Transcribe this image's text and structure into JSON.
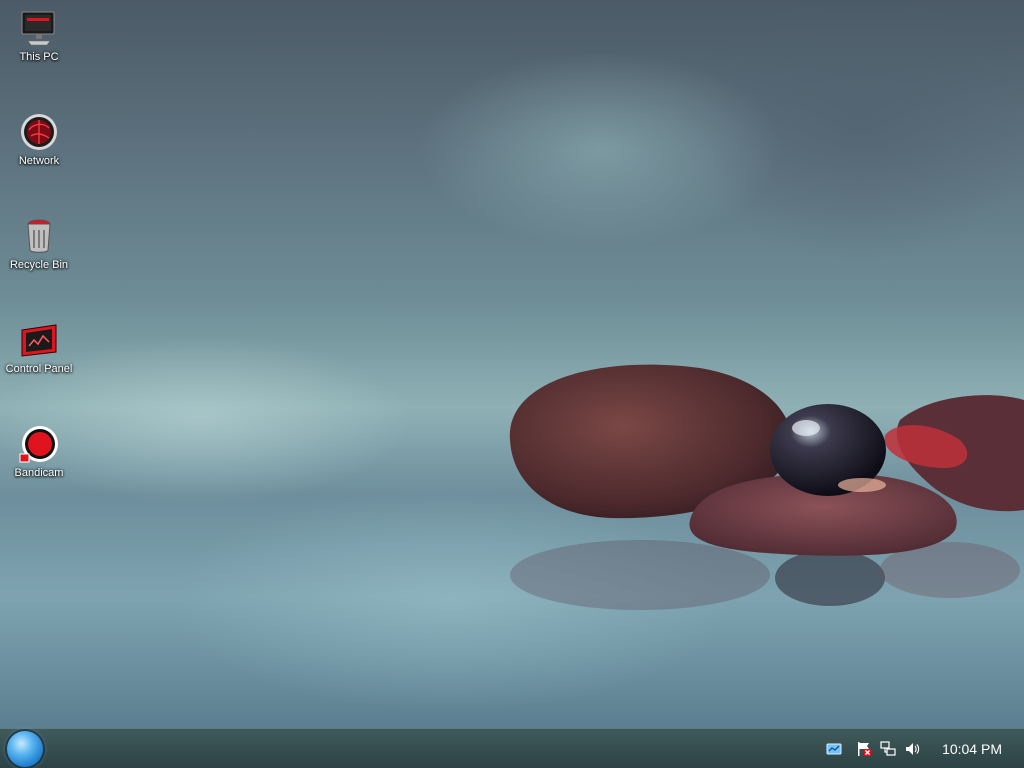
{
  "desktop": {
    "icons": [
      {
        "label": "This PC",
        "icon": "computer-icon"
      },
      {
        "label": "Network",
        "icon": "network-icon"
      },
      {
        "label": "Recycle Bin",
        "icon": "recycle-bin-icon"
      },
      {
        "label": "Control Panel",
        "icon": "control-panel-icon"
      },
      {
        "label": "Bandicam",
        "icon": "bandicam-icon"
      }
    ]
  },
  "taskbar": {
    "start_icon": "start-orb-icon",
    "tray_icons": [
      "action-center-icon",
      "flag-icon",
      "network-icon",
      "volume-icon"
    ],
    "clock": "10:04 PM"
  },
  "colors": {
    "taskbar": "#34494b",
    "accent_red": "#e0141e",
    "start_orb": "#2f8fe0"
  }
}
